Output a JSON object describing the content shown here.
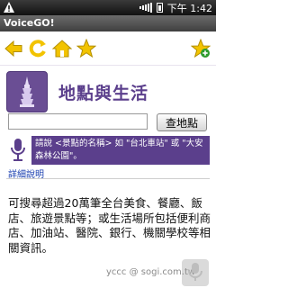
{
  "status_bar": {
    "time": "下午 1:42",
    "icons": [
      "warning-icon",
      "signal-icon",
      "battery-icon"
    ]
  },
  "app": {
    "title": "VoiceGO!"
  },
  "toolbar": {
    "icons": [
      "back-arrow-icon",
      "refresh-icon",
      "home-icon",
      "favorites-star-icon",
      "add-favorite-icon"
    ]
  },
  "hero": {
    "title": "地點與生活"
  },
  "search": {
    "value": "",
    "button_label": "查地點"
  },
  "voice_tip": {
    "text": "請說 <景點的名稱> 如 \"台北車站\" 或 \"大安森林公園\"。"
  },
  "detail_link": {
    "label": "詳細說明"
  },
  "description": {
    "text": "可搜尋超過20萬筆全台美食、餐廳、飯店、旅遊景點等；或生活場所包括便利商店、加油站、醫院、銀行、機關學校等相關資訊。"
  },
  "watermark": {
    "text": "yccc  @ sogi.com.tw"
  },
  "colors": {
    "brand_purple": "#5b3f8c",
    "toolbar_icon_yellow": "#f2c300"
  }
}
